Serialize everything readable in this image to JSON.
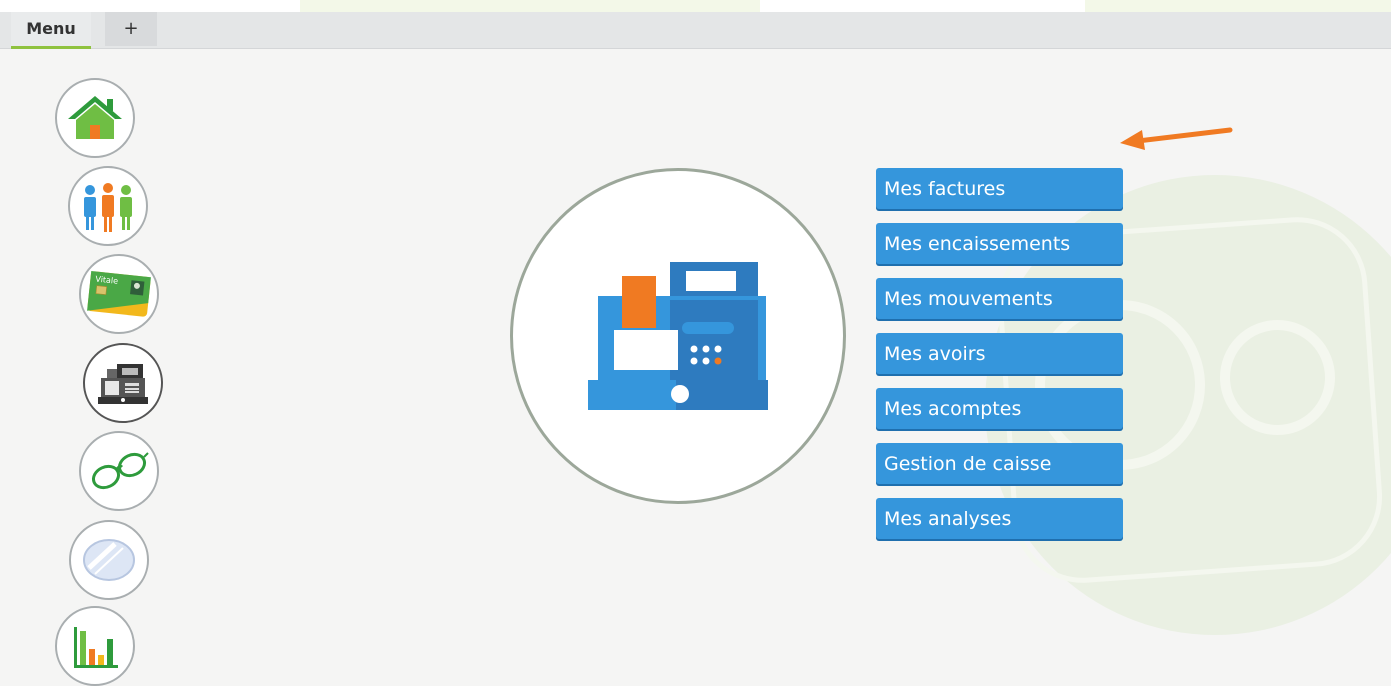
{
  "tabs": [
    {
      "label": "Menu",
      "active": true
    },
    {
      "label": "+"
    }
  ],
  "sidebar": {
    "icons": [
      "home-icon",
      "people-icon",
      "vitale-card-icon",
      "cash-register-icon",
      "glasses-icon",
      "lens-icon",
      "bar-chart-icon"
    ],
    "vitale_text": "Vitale",
    "active": "cash-register-icon"
  },
  "main": {
    "hero_icon": "cash-register-icon",
    "buttons": [
      "Mes factures",
      "Mes encaissements",
      "Mes mouvements",
      "Mes avoirs",
      "Mes acomptes",
      "Gestion de caisse",
      "Mes analyses"
    ]
  },
  "colors": {
    "button": "#3596dc",
    "arrow": "#f07a22",
    "tab_underline": "#8fc23f"
  }
}
